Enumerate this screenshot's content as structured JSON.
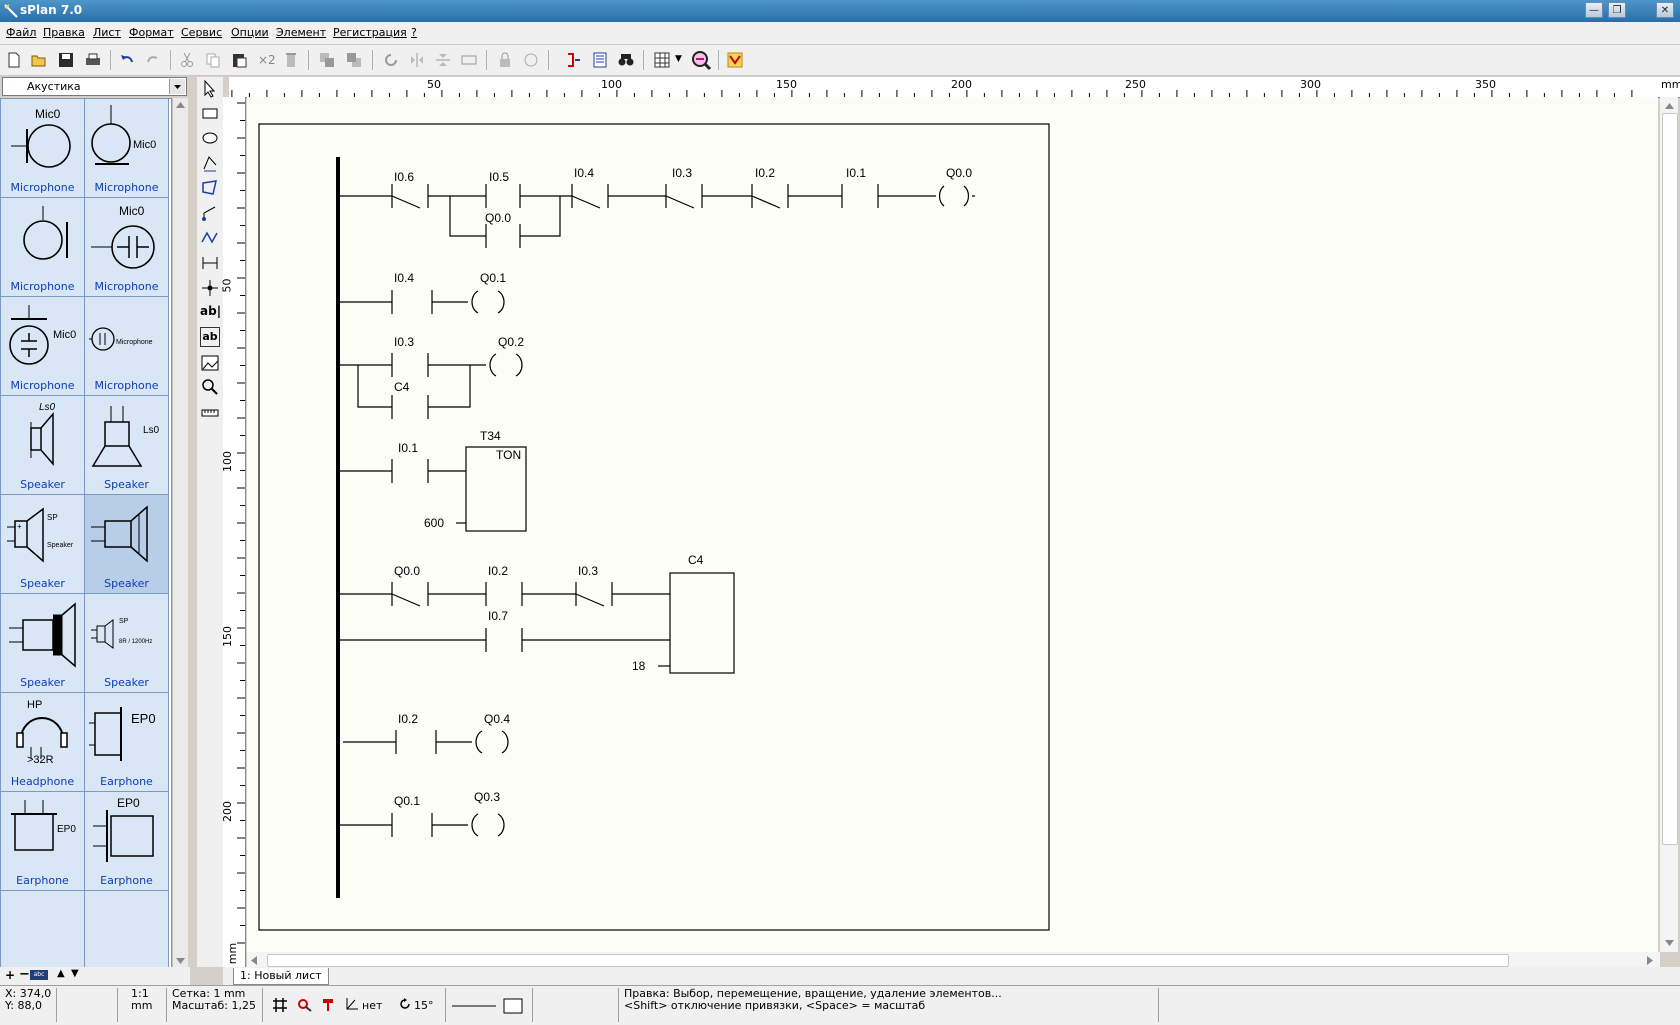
{
  "window": {
    "title": "sPlan 7.0"
  },
  "menu": [
    "Файл",
    "Правка",
    "Лист",
    "Формат",
    "Сервис",
    "Опции",
    "Элемент",
    "Регистрация",
    "?"
  ],
  "toolbar": {
    "x2_label": "×2"
  },
  "library": {
    "selected": "Акустика",
    "items": [
      {
        "label": "Microphone",
        "tag": "Mic0"
      },
      {
        "label": "Microphone",
        "tag": "Mic0"
      },
      {
        "label": "Microphone",
        "tag": ""
      },
      {
        "label": "Microphone",
        "tag": "Mic0"
      },
      {
        "label": "Microphone",
        "tag": "Mic0"
      },
      {
        "label": "Microphone",
        "tag": "Microphone"
      },
      {
        "label": "Speaker",
        "tag": "Ls0"
      },
      {
        "label": "Speaker",
        "tag": "Ls0"
      },
      {
        "label": "Speaker",
        "tag": "SP Speaker"
      },
      {
        "label": "Speaker",
        "tag": ""
      },
      {
        "label": "Speaker",
        "tag": ""
      },
      {
        "label": "Speaker",
        "tag": "SP 8R / 1200Hz"
      },
      {
        "label": "Headphone",
        "tag": "HP >32R"
      },
      {
        "label": "Earphone",
        "tag": "EP0"
      },
      {
        "label": "Earphone",
        "tag": "EP0"
      },
      {
        "label": "Earphone",
        "tag": "EP0"
      }
    ]
  },
  "tools": {
    "text_tool_1": "ab|",
    "text_tool_2": "ab"
  },
  "ruler": {
    "h_ticks": [
      "50",
      "100",
      "150",
      "200",
      "250",
      "300",
      "350"
    ],
    "h_unit": "mm",
    "v_ticks": [
      "50",
      "100",
      "150",
      "200"
    ],
    "v_unit": "mm"
  },
  "schematic": {
    "rung1": {
      "contacts": [
        "I0.6",
        "I0.5",
        "I0.4",
        "I0.3",
        "I0.2",
        "I0.1"
      ],
      "parallel": "Q0.0",
      "coil": "Q0.0"
    },
    "rung2": {
      "contact": "I0.4",
      "coil": "Q0.1"
    },
    "rung3": {
      "contact": "I0.3",
      "parallel": "C4",
      "coil": "Q0.2"
    },
    "rung4": {
      "contact": "I0.1",
      "timer_name": "T34",
      "timer_type": "TON",
      "preset": "600"
    },
    "rung5": {
      "contacts": [
        "Q0.0",
        "I0.2",
        "I0.3"
      ],
      "second": "I0.7",
      "counter": "C4",
      "preset": "18"
    },
    "rung6": {
      "contact": "I0.2",
      "coil": "Q0.4"
    },
    "rung7": {
      "contact": "Q0.1",
      "coil": "Q0.3"
    }
  },
  "tab": {
    "label": "1: Новый лист"
  },
  "status": {
    "x": "X: 374,0",
    "y": "Y: 88,0",
    "scale_ratio": "1:1",
    "scale_unit": "mm",
    "grid": "Сетка: 1 mm",
    "zoom": "Масштаб:  1,25",
    "angle_snap": "нет",
    "rotate": "15°",
    "hint1": "Правка: Выбор, перемещение, вращение, удаление элементов...",
    "hint2": "<Shift> отключение привязки, <Space> = масштаб"
  }
}
